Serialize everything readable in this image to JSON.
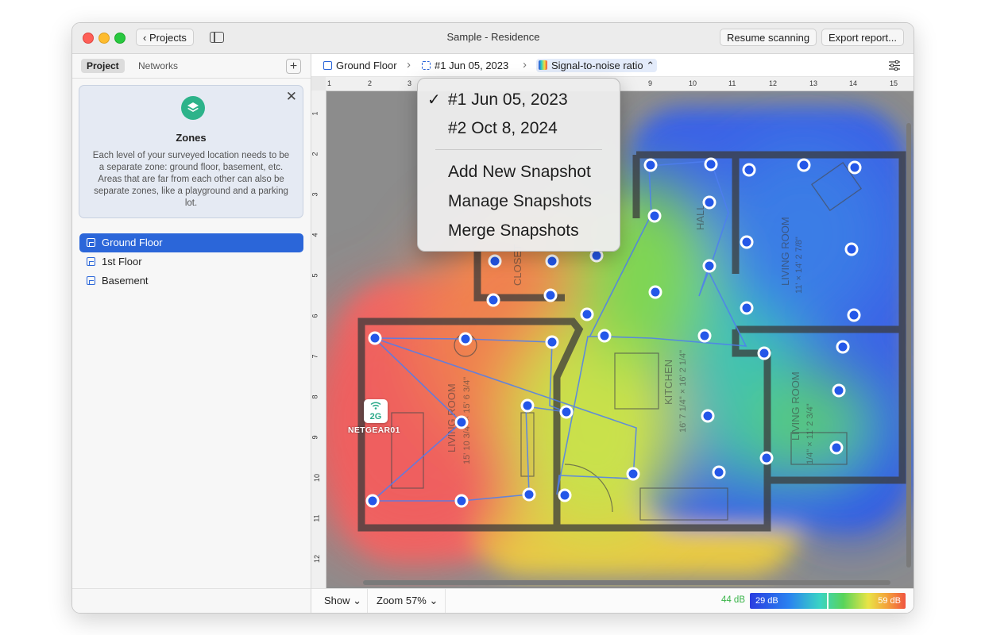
{
  "window": {
    "title": "Sample - Residence",
    "projects_button": "Projects",
    "resume_button": "Resume scanning",
    "export_button": "Export report..."
  },
  "sidebar": {
    "tabs": [
      "Project",
      "Networks"
    ],
    "add_symbol": "+",
    "zones_card": {
      "title": "Zones",
      "text": "Each level of your surveyed location needs to be a separate zone: ground floor, basement, etc. Areas that are far from each other can also be separate zones, like a playground and a parking lot.",
      "close_symbol": "✕"
    },
    "zones": [
      {
        "label": "Ground Floor",
        "selected": true
      },
      {
        "label": "1st Floor",
        "selected": false
      },
      {
        "label": "Basement",
        "selected": false
      }
    ]
  },
  "breadcrumb": {
    "zone": "Ground Floor",
    "snapshot": "#1 Jun 05, 2023",
    "visualization": "Signal-to-noise ratio"
  },
  "snapshot_menu": {
    "items": [
      {
        "label": "#1 Jun 05, 2023",
        "checked": true
      },
      {
        "label": "#2 Oct 8, 2024",
        "checked": false
      }
    ],
    "actions": [
      "Add New Snapshot",
      "Manage Snapshots",
      "Merge Snapshots"
    ]
  },
  "ruler": {
    "top": [
      "1",
      "2",
      "3",
      "9",
      "10",
      "11",
      "12",
      "13",
      "14",
      "15"
    ],
    "left": [
      "1",
      "2",
      "3",
      "4",
      "5",
      "6",
      "7",
      "8",
      "9",
      "10",
      "11",
      "12"
    ]
  },
  "floorplan": {
    "rooms": [
      "LIVING ROOM",
      "KITCHEN",
      "HALL",
      "CLOSET",
      "LIVING ROOM",
      "LIVING ROOM",
      "HALL"
    ],
    "dims": [
      "LIVING ROOM",
      "15' 10 3/4\" × 15' 6 3/4\"",
      "KITCHEN",
      "16' 7 1/4\" × 16' 2 1/4\"",
      "11' × 14' 2 7/8\"",
      "1/4\" × 11' 2 3/4\""
    ],
    "access_point": {
      "band": "2G",
      "name": "NETGEAR01"
    }
  },
  "bottom": {
    "show": "Show",
    "zoom": "Zoom 57%",
    "legend_current": "44 dB",
    "legend_min": "29 dB",
    "legend_max": "59 dB"
  },
  "colors": {
    "accent": "#2b66d9",
    "survey_point": "#2457e8"
  },
  "icons": [
    "chevron-left-icon",
    "sidebar-toggle-icon",
    "plus-icon",
    "layers-icon",
    "close-icon",
    "floor-icon",
    "snapshot-icon",
    "gradient-icon",
    "filter-icon",
    "wifi-icon",
    "checkmark-icon"
  ]
}
